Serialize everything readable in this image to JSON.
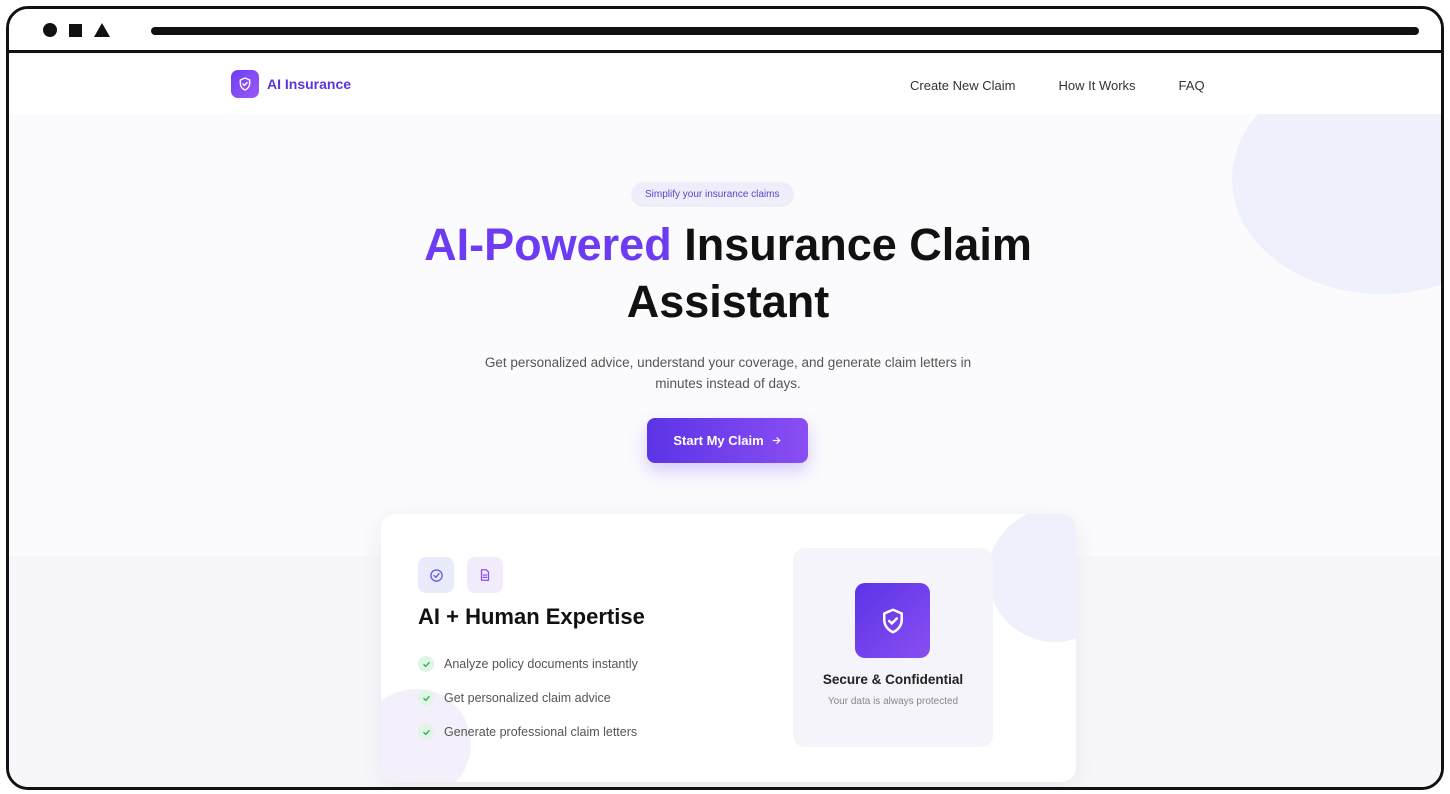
{
  "brand": {
    "name": "AI Insurance"
  },
  "nav": {
    "links": [
      "Create New Claim",
      "How It Works",
      "FAQ"
    ]
  },
  "hero": {
    "pill": "Simplify your insurance claims",
    "headline_accent": "AI-Powered",
    "headline_rest": "Insurance Claim",
    "headline_line2": "Assistant",
    "subtitle": "Get personalized advice, understand your coverage, and generate claim letters in minutes instead of days.",
    "cta_label": "Start My Claim"
  },
  "feature_card": {
    "title": "AI + Human Expertise",
    "items": [
      "Analyze policy documents instantly",
      "Get personalized claim advice",
      "Generate professional claim letters"
    ],
    "icons": [
      "check-circle-icon",
      "document-icon"
    ]
  },
  "secure_panel": {
    "title": "Secure & Confidential",
    "subtitle": "Your data is always protected",
    "icon": "shield-check-icon"
  },
  "colors": {
    "accent": "#6d3cf2",
    "accent_light": "#8a4ef3",
    "check_bg": "#dff5e6",
    "check_green": "#2fae5a"
  }
}
